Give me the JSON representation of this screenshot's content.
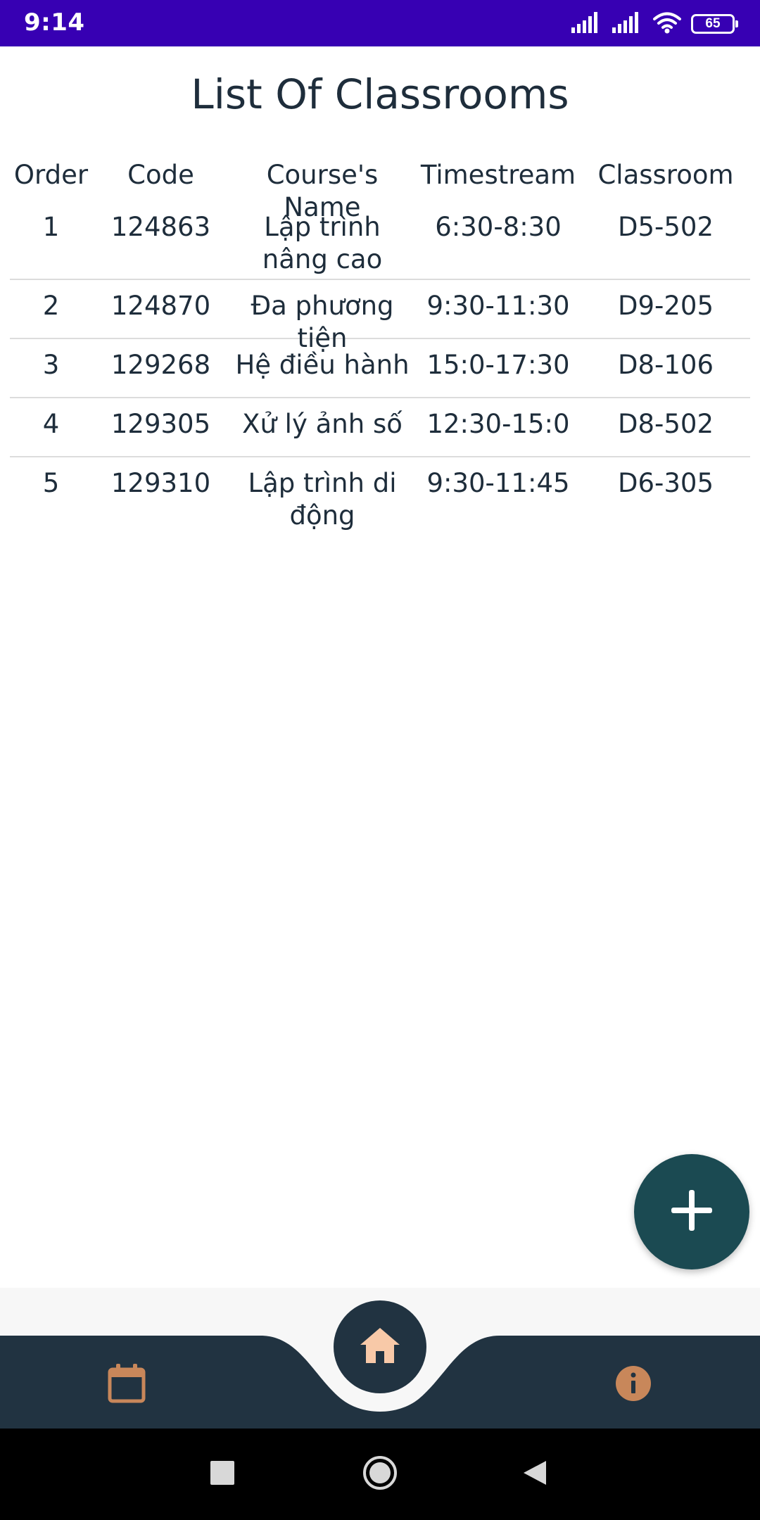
{
  "status_bar": {
    "time": "9:14",
    "battery_level": "65",
    "icons": [
      "signal-icon",
      "signal-icon",
      "wifi-icon",
      "battery-icon"
    ],
    "background_color": "#3700b3"
  },
  "page": {
    "title": "List Of Classrooms"
  },
  "table": {
    "headers": [
      "Order",
      "Code",
      "Course's Name",
      "Timestream",
      "Classroom"
    ],
    "rows": [
      {
        "order": "1",
        "code": "124863",
        "name": "Lập trình nâng cao",
        "time": "6:30-8:30",
        "room": "D5-502"
      },
      {
        "order": "2",
        "code": "124870",
        "name": "Đa phương tiện",
        "time": "9:30-11:30",
        "room": "D9-205"
      },
      {
        "order": "3",
        "code": "129268",
        "name": "Hệ điều hành",
        "time": "15:0-17:30",
        "room": "D8-106"
      },
      {
        "order": "4",
        "code": "129305",
        "name": "Xử lý ảnh số",
        "time": "12:30-15:0",
        "room": "D8-502"
      },
      {
        "order": "5",
        "code": "129310",
        "name": "Lập trình di động",
        "time": "9:30-11:45",
        "room": "D6-305"
      }
    ]
  },
  "fab": {
    "icon": "plus-icon",
    "color": "#1b4a52"
  },
  "bottom_nav": {
    "items": [
      {
        "icon": "calendar-icon",
        "color": "#c8875a"
      },
      {
        "icon": "home-icon",
        "color": "#f8c9a8"
      },
      {
        "icon": "info-icon",
        "color": "#c8875a"
      }
    ],
    "background_color": "#213341"
  },
  "system_nav": {
    "buttons": [
      "recent-apps-icon",
      "home-circle-icon",
      "back-icon"
    ]
  }
}
